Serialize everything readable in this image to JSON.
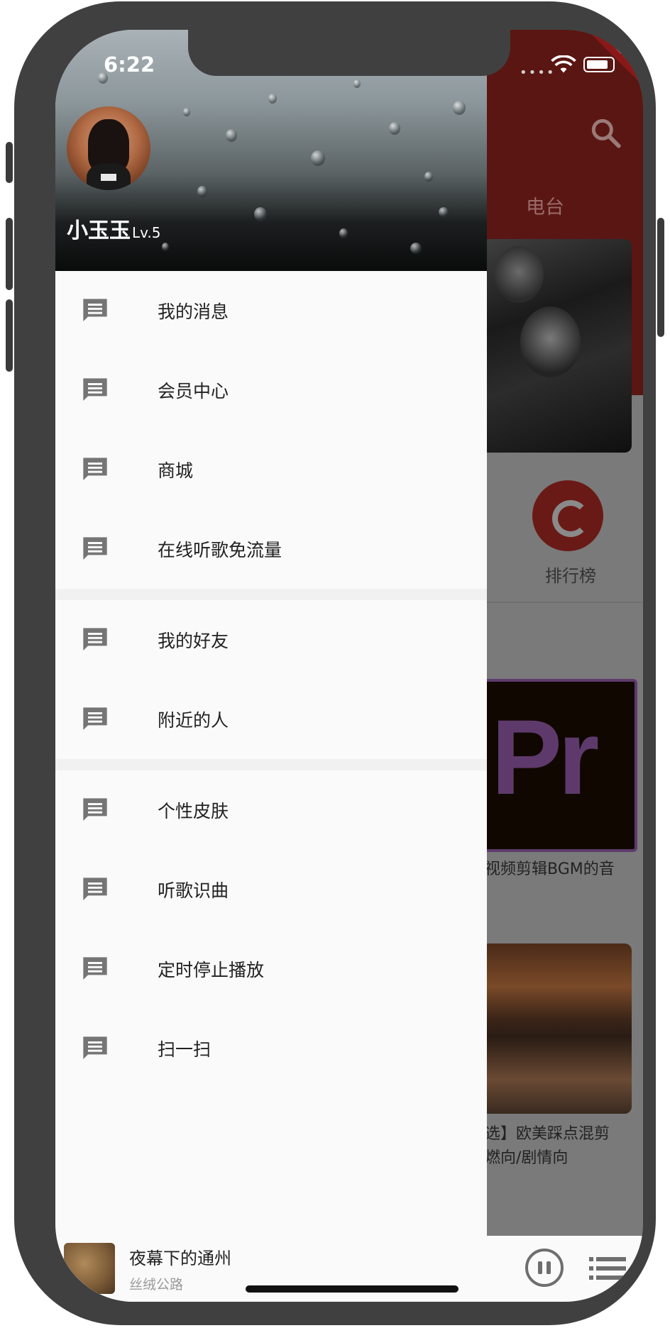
{
  "status_bar": {
    "time": "6:22",
    "debug_label": "DEBUG"
  },
  "drawer": {
    "user": {
      "name": "小玉玉",
      "level": "Lv.5"
    },
    "sections": [
      {
        "items": [
          {
            "label": "我的消息",
            "icon": "message-icon"
          },
          {
            "label": "会员中心",
            "icon": "message-icon"
          },
          {
            "label": "商城",
            "icon": "message-icon"
          },
          {
            "label": "在线听歌免流量",
            "icon": "message-icon"
          }
        ]
      },
      {
        "items": [
          {
            "label": "我的好友",
            "icon": "message-icon"
          },
          {
            "label": "附近的人",
            "icon": "message-icon"
          }
        ]
      },
      {
        "items": [
          {
            "label": "个性皮肤",
            "icon": "message-icon"
          },
          {
            "label": "听歌识曲",
            "icon": "message-icon"
          },
          {
            "label": "定时停止播放",
            "icon": "message-icon"
          },
          {
            "label": "扫一扫",
            "icon": "message-icon"
          }
        ]
      }
    ]
  },
  "background_app": {
    "tab_radio": "电台",
    "ranking_label": "排行榜",
    "card_pr_text": "Pr",
    "card_pr_caption": "视频剪辑BGM的音",
    "card_movie_caption_line1": "选】欧美踩点混剪",
    "card_movie_caption_line2": "燃向/剧情向"
  },
  "player": {
    "title": "夜幕下的通州",
    "artist": "丝绒公路"
  },
  "colors": {
    "accent_dimmed": "#5a1612",
    "drawer_bg": "#fafafa",
    "icon_gray": "#757575"
  }
}
